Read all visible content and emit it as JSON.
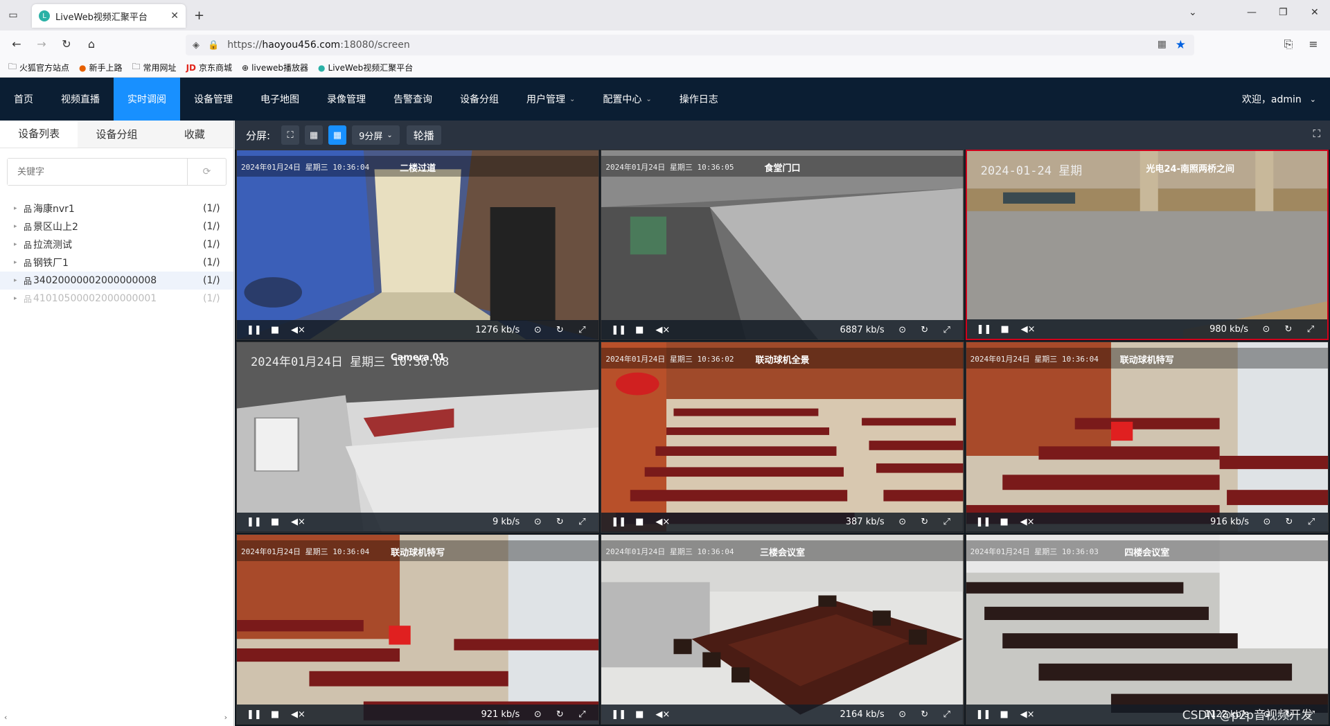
{
  "browser": {
    "tab_title": "LiveWeb视频汇聚平台",
    "url_prefix": "https://",
    "url_host": "haoyou456.com",
    "url_rest": ":18080/screen",
    "bookmarks": [
      "火狐官方站点",
      "新手上路",
      "常用网址",
      "京东商城",
      "liveweb播放器",
      "LiveWeb视频汇聚平台"
    ]
  },
  "nav": {
    "items": [
      {
        "label": "首页"
      },
      {
        "label": "视频直播"
      },
      {
        "label": "实时调阅"
      },
      {
        "label": "设备管理"
      },
      {
        "label": "电子地图"
      },
      {
        "label": "录像管理"
      },
      {
        "label": "告警查询"
      },
      {
        "label": "设备分组"
      },
      {
        "label": "用户管理"
      },
      {
        "label": "配置中心"
      },
      {
        "label": "操作日志"
      }
    ],
    "welcome": "欢迎，admin"
  },
  "sidebar": {
    "tabs": [
      "设备列表",
      "设备分组",
      "收藏"
    ],
    "search_placeholder": "关键字",
    "tree": [
      {
        "name": "海康nvr1",
        "count": "(1/)"
      },
      {
        "name": "景区山上2",
        "count": "(1/)"
      },
      {
        "name": "拉流测试",
        "count": "(1/)"
      },
      {
        "name": "钢铁厂1",
        "count": "(1/)"
      },
      {
        "name": "34020000002000000008",
        "count": "(1/)"
      },
      {
        "name": "41010500002000000001",
        "count": "(1/)"
      }
    ]
  },
  "toolbar": {
    "split_label": "分屏:",
    "split_value": "9分屏",
    "carousel": "轮播"
  },
  "cells": [
    {
      "time": "2024年01月24日 星期三 10:36:04",
      "name": "二楼过道",
      "rate": "1276 kb/s"
    },
    {
      "time": "2024年01月24日 星期三 10:36:05",
      "name": "食堂门口",
      "rate": "6887 kb/s"
    },
    {
      "time": "2024-01-24 星期",
      "name": "光电24-南照两桥之间",
      "rate": "980 kb/s"
    },
    {
      "time": "2024年01月24日 星期三 10:36:08",
      "name": "Camera 01",
      "rate": "9 kb/s"
    },
    {
      "time": "2024年01月24日 星期三 10:36:02",
      "name": "联动球机全景",
      "rate": "387 kb/s"
    },
    {
      "time": "2024年01月24日 星期三 10:36:04",
      "name": "联动球机特写",
      "rate": "916 kb/s"
    },
    {
      "time": "2024年01月24日 星期三 10:36:04",
      "name": "联动球机特写",
      "rate": "921 kb/s"
    },
    {
      "time": "2024年01月24日 星期三 10:36:04",
      "name": "三楼会议室",
      "rate": "2164 kb/s"
    },
    {
      "time": "2024年01月24日 星期三 10:36:03",
      "name": "四楼会议室",
      "rate": "1122 kb/s"
    }
  ],
  "watermark": "CSDN @p2p音视频开发"
}
